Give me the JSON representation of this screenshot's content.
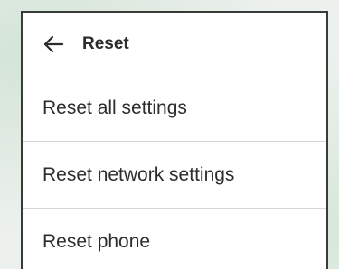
{
  "header": {
    "back_icon": "arrow-left-icon",
    "title": "Reset"
  },
  "menu": {
    "items": [
      {
        "label": "Reset all settings"
      },
      {
        "label": "Reset network settings"
      },
      {
        "label": "Reset phone"
      }
    ]
  },
  "colors": {
    "background": "#edf1ed",
    "card": "#ffffff",
    "text": "#2d2d2d",
    "divider": "#d5d5d5"
  }
}
